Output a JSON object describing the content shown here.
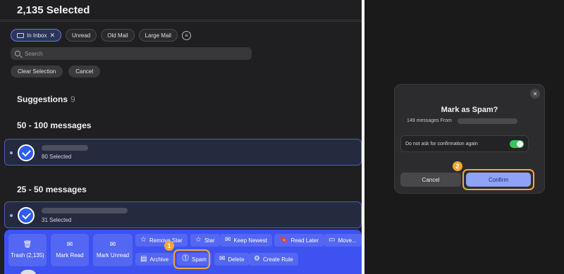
{
  "header": {
    "title": "2,135 Selected"
  },
  "filters": {
    "chips": [
      "In Inbox",
      "Unread",
      "Old Mail",
      "Large Mail"
    ],
    "active_close": "✕"
  },
  "search": {
    "placeholder": "Search"
  },
  "controls": {
    "clear_selection": "Clear Selection",
    "cancel": "Cancel"
  },
  "suggestions": {
    "label": "Suggestions",
    "count": "9"
  },
  "groups": [
    {
      "heading": "50 - 100 messages",
      "selected": "80 Selected"
    },
    {
      "heading": "25 - 50 messages",
      "selected": "31 Selected"
    }
  ],
  "actions": {
    "trash": "Trash (2,135)",
    "mark_read": "Mark Read",
    "mark_unread": "Mark Unread",
    "remove_star": "Remove Star",
    "star": "Star",
    "keep_newest": "Keep Newest",
    "read_later": "Read Later",
    "move": "Move...",
    "archive": "Archive",
    "spam": "Spam",
    "delete": "Delete",
    "create_rule": "Create Rule"
  },
  "callouts": {
    "step1": "1",
    "step2": "2"
  },
  "dialog": {
    "title": "Mark as Spam?",
    "subtitle": "149 messages From",
    "option": "Do not ask for confirmation again",
    "toggle_on": true,
    "cancel": "Cancel",
    "confirm": "Confirm",
    "close": "✕"
  },
  "colors": {
    "accent": "#3d52f0",
    "highlight": "#f2a733",
    "toggle": "#34c759",
    "confirm": "#8ea3f7"
  }
}
